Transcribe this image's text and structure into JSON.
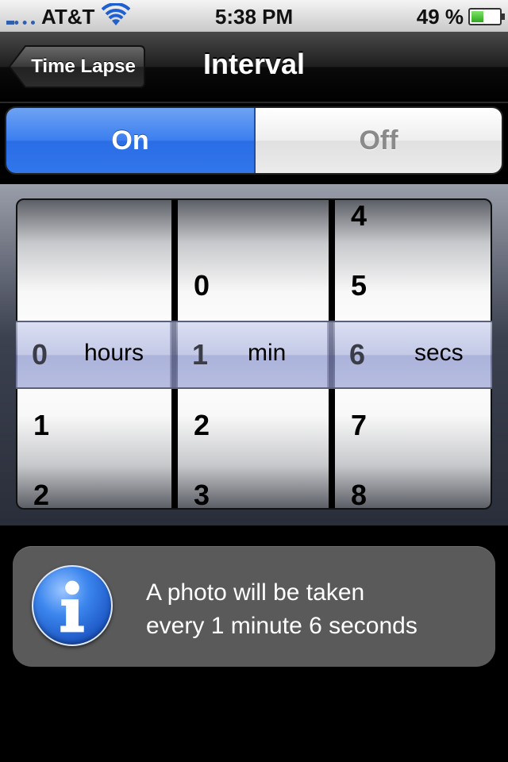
{
  "status": {
    "carrier": "AT&T",
    "time": "5:38 PM",
    "battery_percent": "49 %",
    "battery_level": 0.49
  },
  "nav": {
    "back_label": "Time Lapse",
    "title": "Interval"
  },
  "toggle": {
    "on_label": "On",
    "off_label": "Off",
    "selected": "On"
  },
  "picker": {
    "hours": {
      "above": [],
      "selected": "0",
      "unit": "hours",
      "below": [
        "1",
        "2"
      ]
    },
    "minutes": {
      "above": [
        "0"
      ],
      "selected": "1",
      "unit": "min",
      "below": [
        "2",
        "3"
      ]
    },
    "seconds": {
      "above": [
        "4",
        "5"
      ],
      "selected": "6",
      "unit": "secs",
      "below": [
        "7",
        "8"
      ]
    }
  },
  "info": {
    "line1": "A photo will be taken",
    "line2": "every 1 minute 6 seconds"
  },
  "colors": {
    "accent_blue": "#3b7ef0",
    "info_box": "#5a5a5a"
  }
}
